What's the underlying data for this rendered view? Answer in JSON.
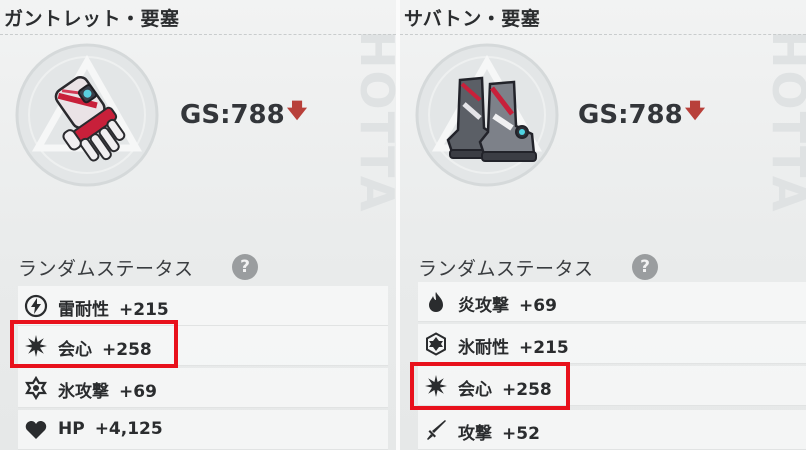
{
  "panels": [
    {
      "title": "ガントレット・要塞",
      "item_icon": "gauntlet-icon",
      "gs_label": "GS:788",
      "gs_trend": "down",
      "random_stats_heading": "ランダムステータス",
      "help_label": "?",
      "watermark": "HOTTA",
      "stats": [
        {
          "icon": "thunder-resist-icon",
          "name": "雷耐性",
          "value": "+215",
          "highlighted": false
        },
        {
          "icon": "crit-icon",
          "name": "会心",
          "value": "+258",
          "highlighted": true
        },
        {
          "icon": "ice-attack-icon",
          "name": "氷攻撃",
          "value": "+69",
          "highlighted": false
        },
        {
          "icon": "heart-icon",
          "name": "HP",
          "value": "+4,125",
          "highlighted": false
        }
      ]
    },
    {
      "title": "サバトン・要塞",
      "item_icon": "sabaton-boots-icon",
      "gs_label": "GS:788",
      "gs_trend": "down",
      "random_stats_heading": "ランダムステータス",
      "help_label": "?",
      "watermark": "HOTTA",
      "stats": [
        {
          "icon": "flame-attack-icon",
          "name": "炎攻撃",
          "value": "+69",
          "highlighted": false
        },
        {
          "icon": "ice-resist-icon",
          "name": "氷耐性",
          "value": "+215",
          "highlighted": false
        },
        {
          "icon": "crit-icon",
          "name": "会心",
          "value": "+258",
          "highlighted": true
        },
        {
          "icon": "sword-attack-icon",
          "name": "攻撃",
          "value": "+52",
          "highlighted": false
        }
      ]
    }
  ],
  "colors": {
    "highlight": "#e8111c",
    "down_arrow": "#b8403a",
    "accent": "#c8203a"
  }
}
